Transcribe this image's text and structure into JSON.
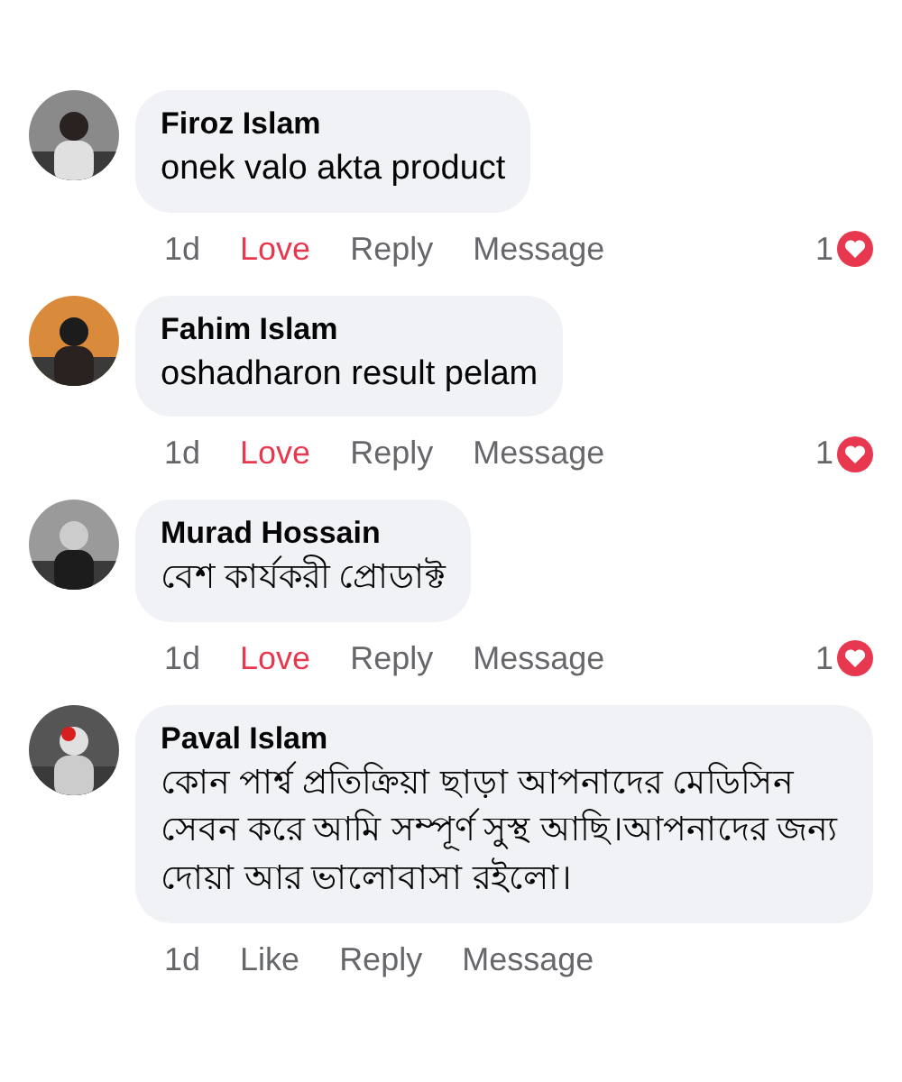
{
  "comments": [
    {
      "author": "Firoz Islam",
      "text": "onek valo akta product",
      "time": "1d",
      "reaction_label": "Love",
      "reacted": true,
      "reply": "Reply",
      "message": "Message",
      "reaction_count": "1"
    },
    {
      "author": "Fahim Islam",
      "text": "oshadharon result pelam",
      "time": "1d",
      "reaction_label": "Love",
      "reacted": true,
      "reply": "Reply",
      "message": "Message",
      "reaction_count": "1"
    },
    {
      "author": "Murad Hossain",
      "text": "বেশ কার্যকরী প্রোডাক্ট",
      "time": "1d",
      "reaction_label": "Love",
      "reacted": true,
      "reply": "Reply",
      "message": "Message",
      "reaction_count": "1"
    },
    {
      "author": "Paval Islam",
      "text": "কোন পার্শ্ব প্রতিক্রিয়া ছাড়া আপনাদের মেডিসিন সেবন করে আমি সম্পূর্ণ সুস্থ আছি।আপনাদের জন্য দোয়া আর ভালোবাসা রইলো।",
      "time": "1d",
      "reaction_label": "Like",
      "reacted": false,
      "reply": "Reply",
      "message": "Message"
    }
  ]
}
